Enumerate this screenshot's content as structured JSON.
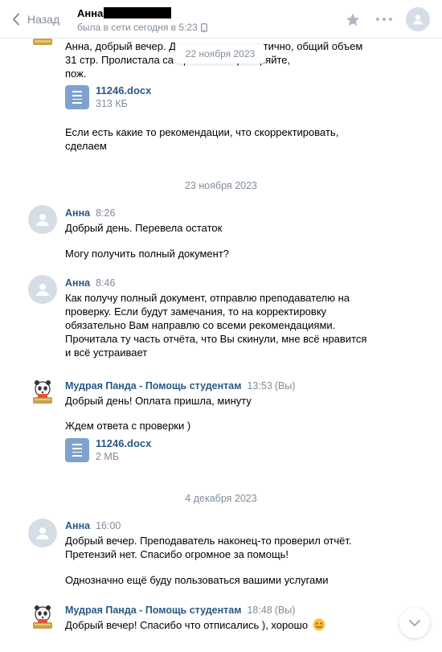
{
  "header": {
    "back_label": "Назад",
    "contact_name": "Анна",
    "status": "была в сети сегодня в 5:23"
  },
  "floating_date": "22 ноября 2023",
  "messages_top": {
    "lines": [
      "Анна, добрый вечер. Да, в нерерывн частично, общий объем",
      "31 стр. Пролистала са                      ще все ок. Проверяйте,",
      "пож."
    ],
    "doc1": {
      "name": "11246.docx",
      "size": "313 КБ"
    },
    "followup": [
      "Если есть какие то рекомендации, что скорректировать,",
      "сделаем"
    ]
  },
  "day1": "23 ноября 2023",
  "msg_anna_1": {
    "sender": "Анна",
    "time": "8:26",
    "lines": [
      "Добрый день. Перевела остаток"
    ],
    "lines2": [
      "Могу получить полный документ?"
    ]
  },
  "msg_anna_2": {
    "sender": "Анна",
    "time": "8:46",
    "lines": [
      "Как получу полный документ, отправлю преподавателю на",
      "проверку. Если будут замечания, то на корректировку",
      "обязательно Вам направлю со всеми рекомендациями.",
      "Прочитала ту часть отчёта, что Вы скинули, мне всё нравится",
      "и всё устраивает"
    ]
  },
  "msg_panda_1": {
    "sender": "Мудрая Панда - Помощь студентам",
    "time": "13:53",
    "time_suffix": "(Вы)",
    "lines": [
      "Добрый день! Оплата пришла, минуту"
    ],
    "lines2": [
      "Ждем ответа с проверки )"
    ],
    "doc": {
      "name": "11246.docx",
      "size": "2 МБ"
    }
  },
  "day2": "4 декабря 2023",
  "msg_anna_3": {
    "sender": "Анна",
    "time": "16:00",
    "lines": [
      "Добрый вечер. Преподаватель наконец-то проверил отчёт.",
      "Претензий нет. Спасибо огромное за помощь!"
    ],
    "lines2": [
      "Однозначно ещё буду пользоваться вашими услугами"
    ]
  },
  "msg_panda_2": {
    "sender": "Мудрая Панда - Помощь студентам",
    "time": "18:48",
    "time_suffix": "(Вы)",
    "text": "Добрый вечер! Спасибо что отписались ), хорошо"
  },
  "icons": {
    "back": "chevron-left-icon",
    "star": "star-icon",
    "more": "more-horizontal-icon",
    "scroll": "chevron-down-icon",
    "emoji": "smile-emoji-icon"
  },
  "colors": {
    "link": "#2a5885",
    "muted": "#818c99",
    "doc_icon": "#7ea2cf",
    "avatar_placeholder": "#d5dde6"
  }
}
